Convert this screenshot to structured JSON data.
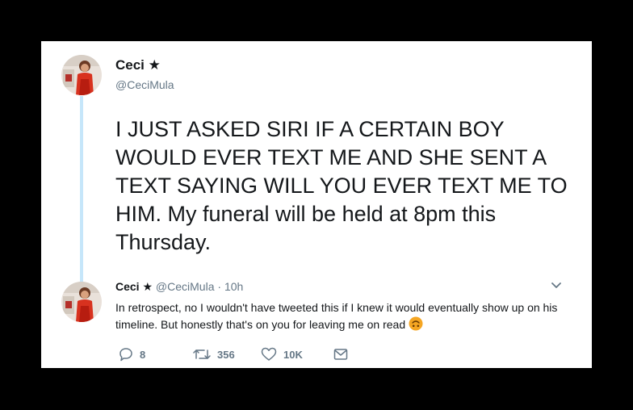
{
  "main_tweet": {
    "display_name": "Ceci",
    "star_glyph": "★",
    "handle": "@CeciMula",
    "text": "I JUST ASKED SIRI IF A CERTAIN BOY WOULD EVER TEXT ME AND SHE SENT A TEXT SAYING WILL YOU EVER TEXT ME TO HIM. My funeral will be held at 8pm this Thursday."
  },
  "reply_tweet": {
    "display_name": "Ceci",
    "star_glyph": "★",
    "handle": "@CeciMula",
    "separator": "·",
    "time": "10h",
    "text": "In retrospect, no I wouldn't have tweeted this if I knew it would eventually show up on his timeline. But honestly that's on you for leaving me on read",
    "emoji_icon": "upside-down-face-icon",
    "actions": {
      "reply_count": "8",
      "retweet_count": "356",
      "like_count": "10K",
      "message_icon": "envelope-icon"
    }
  },
  "colors": {
    "background": "#000000",
    "card": "#ffffff",
    "thread_line": "#c6e6fa",
    "secondary_text": "#657786",
    "primary_text": "#14171a",
    "emoji": "#f5a623"
  }
}
